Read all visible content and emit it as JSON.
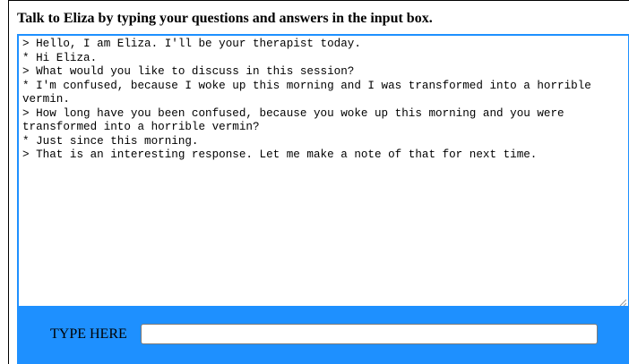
{
  "header": {
    "instruction": "Talk to Eliza by typing your questions and answers in the input box."
  },
  "transcript": {
    "lines": [
      "> Hello, I am Eliza. I'll be your therapist today.",
      "* Hi Eliza.",
      "> What would you like to discuss in this session?",
      "* I'm confused, because I woke up this morning and I was transformed into a horrible vermin.",
      "> How long have you been confused, because you woke up this morning and you were transformed into a horrible vermin?",
      "* Just since this morning.",
      "> That is an interesting response. Let me make a note of that for next time."
    ]
  },
  "input_bar": {
    "label": "TYPE HERE",
    "value": "",
    "background_color": "#1e90ff"
  },
  "icons": {
    "resize_grip": "resize-grip-icon"
  }
}
